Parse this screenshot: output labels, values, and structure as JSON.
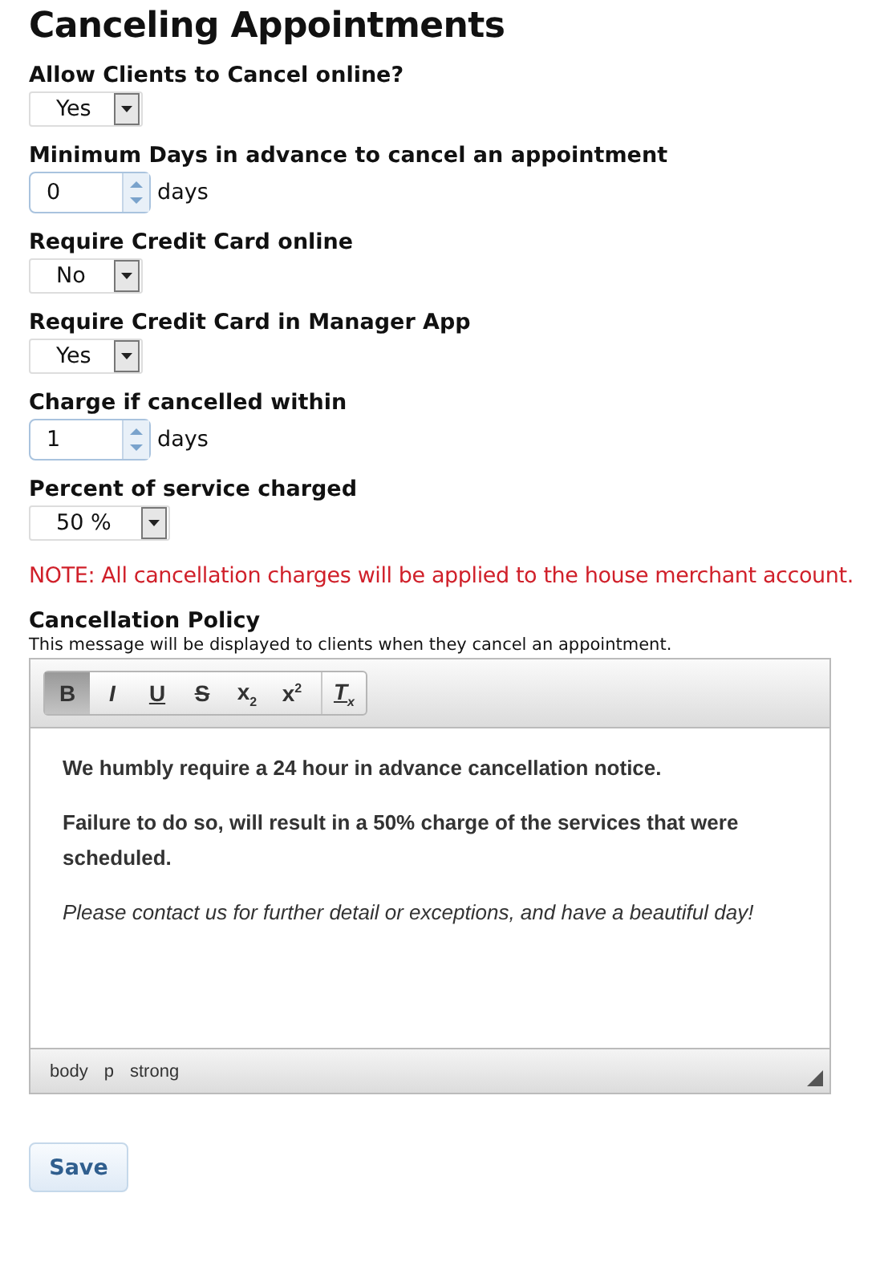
{
  "title": "Canceling Appointments",
  "fields": [
    {
      "label": "Allow Clients to Cancel online?",
      "kind": "select",
      "value": "Yes"
    },
    {
      "label": "Minimum Days in advance to cancel an appointment",
      "kind": "spinner",
      "value": "0",
      "unit": "days"
    },
    {
      "label": "Require Credit Card online",
      "kind": "select",
      "value": "No"
    },
    {
      "label": "Require Credit Card in Manager App",
      "kind": "select",
      "value": "Yes"
    },
    {
      "label": "Charge if cancelled within",
      "kind": "spinner",
      "value": "1",
      "unit": "days"
    },
    {
      "label": "Percent of service charged",
      "kind": "select",
      "value": "50 %",
      "wide": true
    }
  ],
  "note": "NOTE: All cancellation charges will be applied to the house merchant account.",
  "policy": {
    "label": "Cancellation Policy",
    "hint": "This message will be displayed to clients when they cancel an appointment.",
    "toolbar": [
      {
        "text": "B",
        "kind": "bold",
        "selected": true
      },
      {
        "text": "I",
        "kind": "italic",
        "selected": false
      },
      {
        "text": "U",
        "kind": "underline",
        "selected": false
      },
      {
        "text": "S",
        "kind": "strike",
        "selected": false
      },
      {
        "text": "x$_{2}$",
        "kind": "plain",
        "selected": false
      },
      {
        "text": "x$^{2}$",
        "kind": "plain",
        "selected": false
      },
      {
        "text": "T$_{x}$",
        "kind": "clear",
        "selected": false
      }
    ],
    "paragraphs": [
      {
        "text": "We humbly require a 24 hour in advance cancellation notice.",
        "kind": "bold"
      },
      {
        "text": "Failure to do so, will result in a 50% charge of the services that were scheduled.",
        "kind": "bold"
      },
      {
        "text": "Please contact us for further detail or exceptions, and have a beautiful day!",
        "kind": "italic"
      }
    ],
    "path": [
      "body",
      "p",
      "strong"
    ]
  },
  "save": "Save"
}
